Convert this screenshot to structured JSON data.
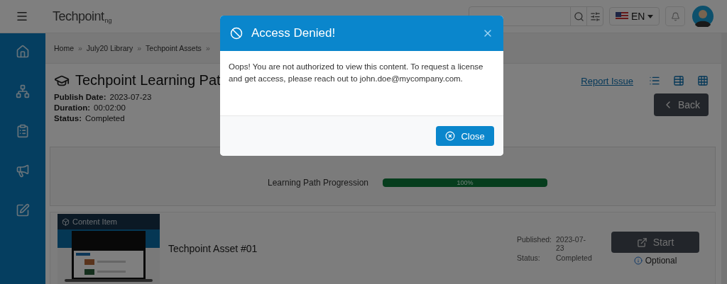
{
  "header": {
    "brand": "Techpoint",
    "brand_sub": "ng",
    "language": "EN"
  },
  "breadcrumb": {
    "separator": "»",
    "items": [
      "Home",
      "July20 Library",
      "Techpoint Assets"
    ]
  },
  "page": {
    "title": "Techpoint Learning Pat",
    "meta": [
      {
        "label": "Publish Date:",
        "value": "2023-07-23"
      },
      {
        "label": "Duration:",
        "value": "00:02:00"
      },
      {
        "label": "Status:",
        "value": "Completed"
      }
    ],
    "report_link": "Report Issue",
    "back": "Back"
  },
  "progress": {
    "label": "Learning Path Progression",
    "level": 1,
    "reading": "100%"
  },
  "items": [
    {
      "badge": "Content Item",
      "title": "Techpoint Asset #01",
      "published_label": "Published:",
      "published": "2023-07-23",
      "status_label": "Status:",
      "status": "Completed",
      "action": "Start",
      "note": "Optional"
    }
  ],
  "dialog": {
    "title": "Access Denied!",
    "message": "Oops! You are not authorized to view this content. To request a license and get access, please reach out to john.doe@mycompany.com.",
    "close": "Close"
  }
}
